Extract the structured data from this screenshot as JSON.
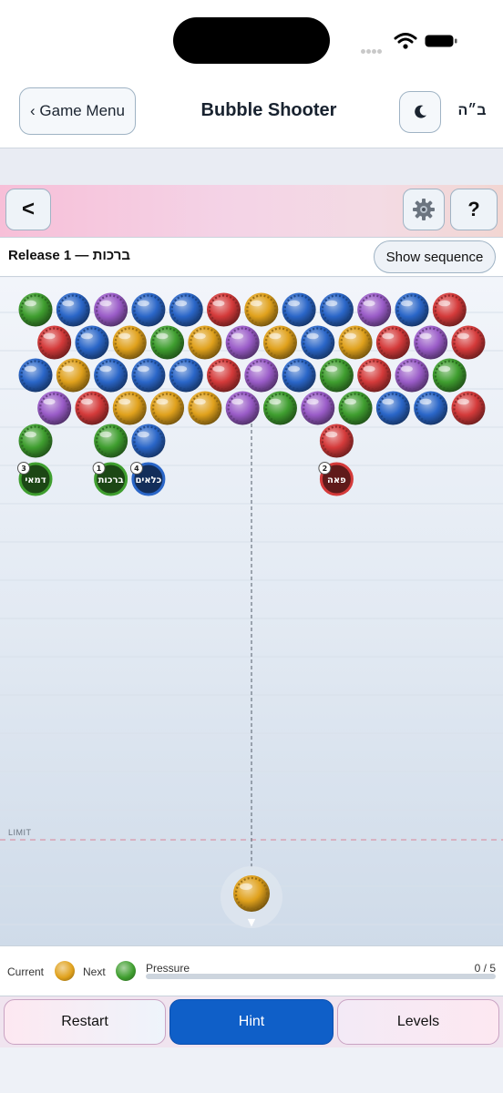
{
  "header": {
    "back_label": "‹ Game Menu",
    "title": "Bubble Shooter",
    "corner_text": "ב״ה"
  },
  "toolbar": {
    "back_label": "<",
    "help_label": "?"
  },
  "level": {
    "label": "Release ברכות — 1",
    "sequence_button": "Show sequence"
  },
  "board": {
    "limit_label": "LIMIT",
    "colors": {
      "G": "#3f9e2f",
      "B": "#2a66c8",
      "P": "#9a5cc8",
      "R": "#d43a3a",
      "Y": "#e0a11c"
    },
    "rows": [
      "GBPBBRYBBPBR",
      "RBYGYPYBYRPR",
      "BYBBBRPBGRPG",
      "PRYYYPGPGBBR",
      "G_GB____R___"
    ],
    "tags": [
      {
        "text": "דמאי",
        "count": "3",
        "color": "G"
      },
      {
        "text": "ברכות",
        "count": "1",
        "color": "G"
      },
      {
        "text": "כלאים",
        "count": "4",
        "color": "B"
      },
      {
        "text": "פאה",
        "count": "2",
        "color": "R"
      }
    ],
    "shooter_color": "Y",
    "aim_indicator": "▼"
  },
  "status": {
    "current_label": "Current",
    "current_color": "Y",
    "next_label": "Next",
    "next_color": "G",
    "pressure_label": "Pressure",
    "pressure_value": "0 / 5",
    "pressure_fraction": 0
  },
  "actions": {
    "restart_label": "Restart",
    "hint_label": "Hint",
    "levels_label": "Levels"
  }
}
